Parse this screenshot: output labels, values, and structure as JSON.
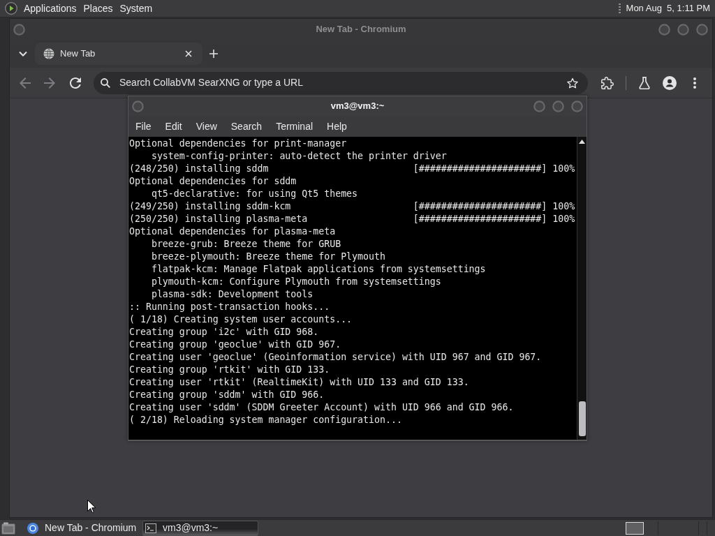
{
  "top_panel": {
    "menus": [
      "Applications",
      "Places",
      "System"
    ],
    "clock": "Mon Aug  5, 1:11 PM"
  },
  "browser": {
    "title": "New Tab - Chromium",
    "active": false,
    "tabs": [
      {
        "label": "New Tab",
        "selected": true
      }
    ],
    "nav_buttons": [
      {
        "kind": "back",
        "disabled": true
      },
      {
        "kind": "forward",
        "disabled": true
      },
      {
        "kind": "reload",
        "disabled": false
      }
    ],
    "omnibox": {
      "placeholder": "Search CollabVM SearXNG or type a URL"
    }
  },
  "terminal": {
    "title": "vm3@vm3:~",
    "active": true,
    "menu": [
      "File",
      "Edit",
      "View",
      "Search",
      "Terminal",
      "Help"
    ],
    "lines": [
      "Optional dependencies for print-manager",
      "    system-config-printer: auto-detect the printer driver",
      "(248/250) installing sddm                          [######################] 100%",
      "Optional dependencies for sddm",
      "    qt5-declarative: for using Qt5 themes",
      "(249/250) installing sddm-kcm                      [######################] 100%",
      "(250/250) installing plasma-meta                   [######################] 100%",
      "Optional dependencies for plasma-meta",
      "    breeze-grub: Breeze theme for GRUB",
      "    breeze-plymouth: Breeze theme for Plymouth",
      "    flatpak-kcm: Manage Flatpak applications from systemsettings",
      "    plymouth-kcm: Configure Plymouth from systemsettings",
      "    plasma-sdk: Development tools",
      ":: Running post-transaction hooks...",
      "( 1/18) Creating system user accounts...",
      "Creating group 'i2c' with GID 968.",
      "Creating group 'geoclue' with GID 967.",
      "Creating user 'geoclue' (Geoinformation service) with UID 967 and GID 967.",
      "Creating group 'rtkit' with GID 133.",
      "Creating user 'rtkit' (RealtimeKit) with UID 133 and GID 133.",
      "Creating group 'sddm' with GID 966.",
      "Creating user 'sddm' (SDDM Greeter Account) with UID 966 and GID 966.",
      "( 2/18) Reloading system manager configuration..."
    ]
  },
  "taskbar": {
    "tasks": [
      {
        "kind": "browser",
        "label": "New Tab - Chromium",
        "selected": false
      },
      {
        "kind": "terminal",
        "label": "vm3@vm3:~",
        "selected": true
      }
    ]
  }
}
